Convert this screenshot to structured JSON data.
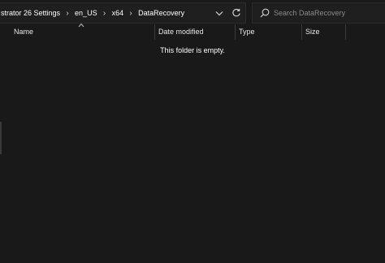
{
  "address_bar": {
    "breadcrumbs": [
      {
        "label": "strator 26 Settings"
      },
      {
        "label": "en_US"
      },
      {
        "label": "x64"
      },
      {
        "label": "DataRecovery"
      }
    ],
    "separator_icon": "chevron-right-icon",
    "dropdown_icon": "chevron-down-icon",
    "refresh_icon": "refresh-icon"
  },
  "search": {
    "placeholder": "Search DataRecovery",
    "value": "",
    "icon": "search-icon"
  },
  "columns": {
    "name": "Name",
    "date_modified": "Date modified",
    "type": "Type",
    "size": "Size",
    "sort_icon": "sort-up-icon"
  },
  "content": {
    "empty_message": "This folder is empty."
  },
  "colors": {
    "background": "#191919",
    "bar_background": "#1f1f1f",
    "text": "#ffffff",
    "placeholder": "#8a8a8a"
  }
}
